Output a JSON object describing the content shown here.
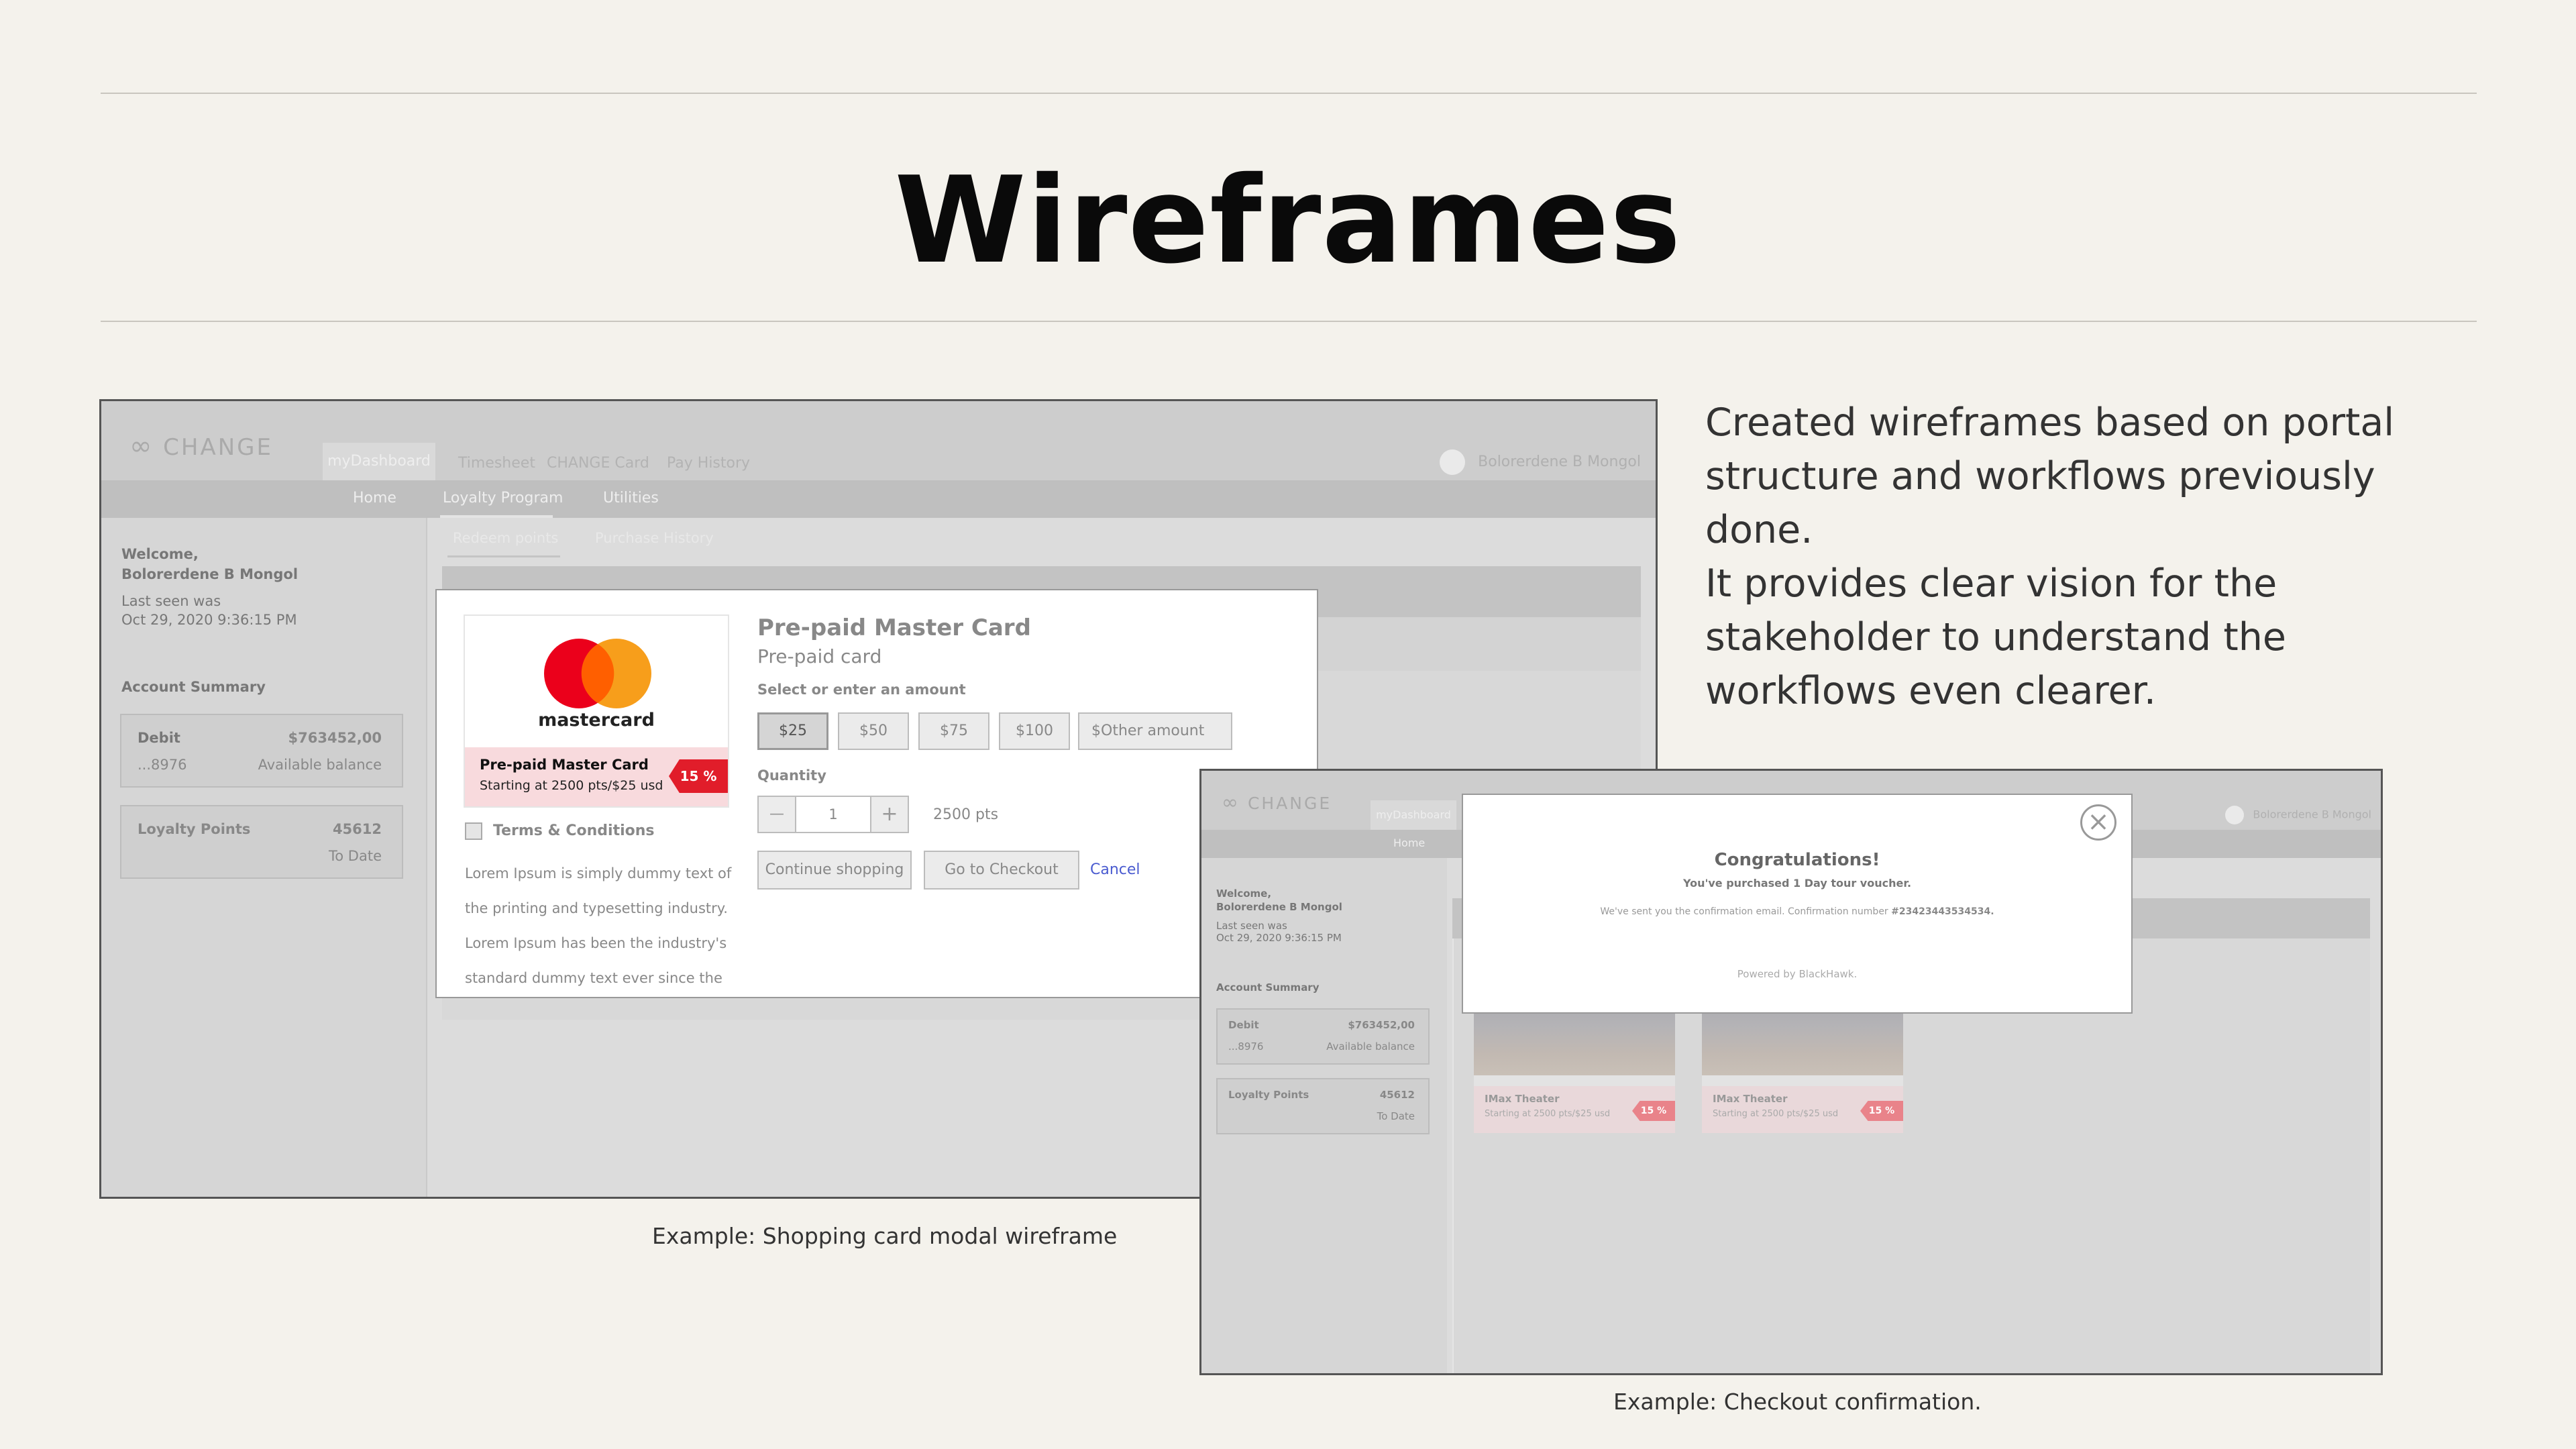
{
  "slide": {
    "title": "Wireframes",
    "description": [
      "Created wireframes based on portal structure and workflows previously done.",
      "It provides clear vision for the stakeholder to understand the workflows even clearer."
    ],
    "caption_left": "Example: Shopping card modal wireframe",
    "caption_right": "Example: Checkout confirmation."
  },
  "wf1": {
    "logo": "CHANGE",
    "tabs": [
      "myDashboard",
      "Timesheet",
      "CHANGE Card",
      "Pay History"
    ],
    "user": "Bolorerdene B Mongol",
    "subnav": [
      "Home",
      "Loyalty Program",
      "Utilities"
    ],
    "subtabs": [
      "Redeem points",
      "Purchase History"
    ],
    "welcome": "Welcome,",
    "username": "Bolorerdene B Mongol",
    "last_seen_label": "Last seen was",
    "last_seen": "Oct 29, 2020 9:36:15 PM",
    "account_summary": "Account Summary",
    "debit_label": "Debit",
    "debit_value": "$763452,00",
    "debit_acct": "...8976",
    "debit_sub": "Available balance",
    "loyalty_label": "Loyalty Points",
    "loyalty_value": "45612",
    "loyalty_sub": "To Date",
    "modal": {
      "brand": "mastercard",
      "card_title": "Pre-paid Master Card",
      "card_sub": "Starting at 2500 pts/$25 usd",
      "badge": "15 %",
      "heading": "Pre-paid Master Card",
      "subheading": "Pre-paid card",
      "amount_label": "Select or enter an amount",
      "amounts": [
        "$25",
        "$50",
        "$75",
        "$100"
      ],
      "other_placeholder": "$Other amount",
      "quantity_label": "Quantity",
      "minus": "—",
      "quantity": "1",
      "plus": "+",
      "points": "2500 pts",
      "terms": "Terms & Conditions",
      "lorem": [
        "Lorem Ipsum is simply dummy text of",
        "the printing and typesetting industry.",
        "Lorem Ipsum has been the industry's",
        "standard dummy text ever since the"
      ],
      "continue": "Continue shopping",
      "checkout": "Go to Checkout",
      "cancel": "Cancel"
    }
  },
  "wf2": {
    "logo": "CHANGE",
    "tab": "myDashboard",
    "user": "Bolorerdene B Mongol",
    "subnav": "Home",
    "welcome": "Welcome,",
    "username": "Bolorerdene B Mongol",
    "last_seen_label": "Last seen was",
    "last_seen": "Oct 29, 2020 9:36:15 PM",
    "account_summary": "Account Summary",
    "debit_label": "Debit",
    "debit_value": "$763452,00",
    "debit_acct": "...8976",
    "debit_sub": "Available balance",
    "loyalty_label": "Loyalty Points",
    "loyalty_value": "45612",
    "loyalty_sub": "To Date",
    "tiles": [
      {
        "title": "IMax Theater",
        "sub": "Starting at 2500 pts/$25 usd",
        "badge": "15 %"
      },
      {
        "title": "IMax Theater",
        "sub": "Starting at 2500 pts/$25 usd",
        "badge": "15 %"
      }
    ],
    "modal": {
      "close": "×",
      "title": "Congratulations!",
      "subtitle": "You've purchased 1 Day tour voucher.",
      "message_pre": "We've sent you the confirmation email. Confirmation number ",
      "confirmation": "#23423443534534.",
      "powered": "Powered by BlackHawk."
    }
  }
}
